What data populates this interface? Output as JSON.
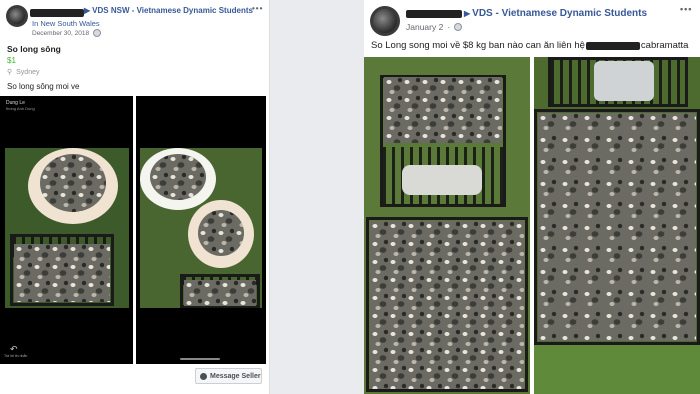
{
  "left_post": {
    "group": "VDS NSW - Vietnamese Dynamic Students",
    "subgroup": "In New South Wales",
    "date": "December 30, 2018",
    "title": "So long sông",
    "price": "$1",
    "location": "Sydney",
    "description": "So long sông moi ve",
    "menu": "•••",
    "message_button": "Message Seller",
    "screenshot_name": "Dung Le",
    "screenshot_sub": "thong Anh Dung",
    "screenshot_footer": "Trả lời tin nhắn"
  },
  "right_post": {
    "group": "VDS - Vietnamese Dynamic Students",
    "date": "January 2",
    "text_before": "So Long song moi về $8 kg ban nào can ăn liên hệ",
    "text_after": "cabramatta",
    "menu": "•••"
  },
  "icons": {
    "share_arrow": "arrow-icon",
    "globe": "globe-icon",
    "location": "location-pin-icon",
    "messenger": "messenger-icon"
  }
}
